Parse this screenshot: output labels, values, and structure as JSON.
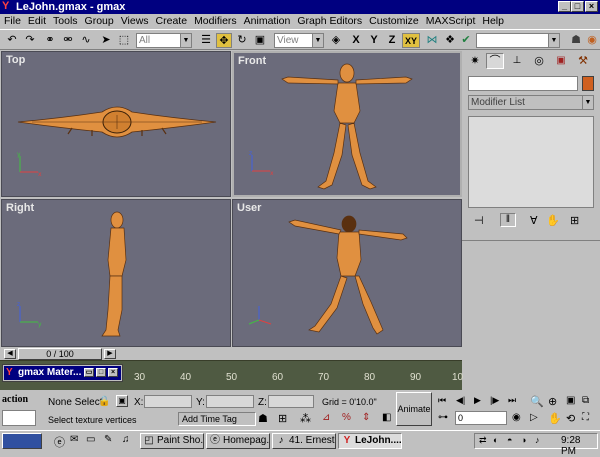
{
  "window": {
    "title": "LeJohn.gmax - gmax"
  },
  "menu": [
    "File",
    "Edit",
    "Tools",
    "Group",
    "Views",
    "Create",
    "Modifiers",
    "Animation",
    "Graph Editors",
    "Customize",
    "MAXScript",
    "Help"
  ],
  "toolbar": {
    "selection_filter": "All",
    "coord_system": "View",
    "axis_x": "X",
    "axis_y": "Y",
    "axis_z": "Z",
    "axis_xy": "XY"
  },
  "viewports": {
    "top": "Top",
    "front": "Front",
    "right": "Right",
    "user": "User"
  },
  "command_panel": {
    "modifier_list": "Modifier List"
  },
  "timeline": {
    "frame_counter": "0 / 100",
    "ticks": [
      "30",
      "40",
      "50",
      "60",
      "70",
      "80",
      "90",
      "10"
    ],
    "float_window": "gmax Mater..."
  },
  "status": {
    "action_label": "action",
    "selection": "None Select",
    "x_label": "X:",
    "y_label": "Y:",
    "z_label": "Z:",
    "grid": "Grid = 0'10.0\"",
    "animate": "Animate",
    "prompt": "Select texture vertices",
    "add_time_tag": "Add Time Tag",
    "frame_value": "0"
  },
  "taskbar": {
    "tasks": [
      "Paint Sho...",
      "Homepag...",
      "41. Ernest...",
      "LeJohn...."
    ],
    "clock": "9:28 PM"
  }
}
